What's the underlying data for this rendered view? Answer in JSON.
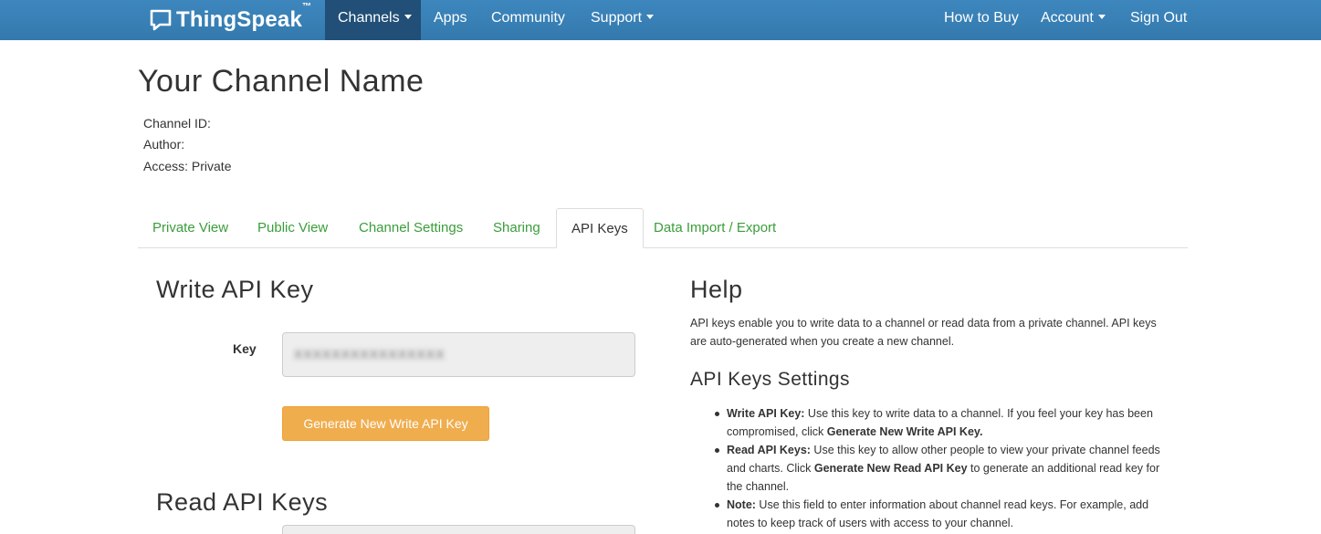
{
  "navbar": {
    "brand": "ThingSpeak",
    "brand_tm": "™",
    "items": [
      {
        "label": "Channels",
        "dropdown": true,
        "active": true
      },
      {
        "label": "Apps"
      },
      {
        "label": "Community"
      },
      {
        "label": "Support",
        "dropdown": true
      }
    ],
    "right_items": [
      {
        "label": "How to Buy"
      },
      {
        "label": "Account",
        "dropdown": true
      },
      {
        "label": "Sign Out"
      }
    ]
  },
  "channel": {
    "title": "Your Channel Name",
    "id_label": "Channel ID:",
    "author_label": "Author:",
    "access": "Access: Private"
  },
  "tabs": [
    {
      "label": "Private View"
    },
    {
      "label": "Public View"
    },
    {
      "label": "Channel Settings"
    },
    {
      "label": "Sharing"
    },
    {
      "label": "API Keys",
      "active": true
    },
    {
      "label": "Data Import / Export"
    }
  ],
  "write_key": {
    "heading": "Write API Key",
    "key_label": "Key",
    "key_value": "XXXXXXXXXXXXXXXX",
    "button": "Generate New Write API Key"
  },
  "read_keys": {
    "heading": "Read API Keys"
  },
  "help": {
    "heading": "Help",
    "intro": "API keys enable you to write data to a channel or read data from a private channel. API keys are auto-generated when you create a new channel.",
    "settings_heading": "API Keys Settings",
    "items": [
      {
        "term": "Write API Key:",
        "text_a": " Use this key to write data to a channel. If you feel your key has been compromised, click ",
        "bold_b": "Generate New Write API Key.",
        "text_c": ""
      },
      {
        "term": "Read API Keys:",
        "text_a": " Use this key to allow other people to view your private channel feeds and charts. Click ",
        "bold_b": "Generate New Read API Key",
        "text_c": " to generate an additional read key for the channel."
      },
      {
        "term": "Note:",
        "text_a": " Use this field to enter information about channel read keys. For example, add notes to keep track of users with access to your channel.",
        "bold_b": "",
        "text_c": ""
      }
    ]
  },
  "colors": {
    "navbar": "#3479ad",
    "navbar_active": "#214f77",
    "tab_link": "#3a9d3a",
    "warning_button": "#f0ad4e"
  }
}
